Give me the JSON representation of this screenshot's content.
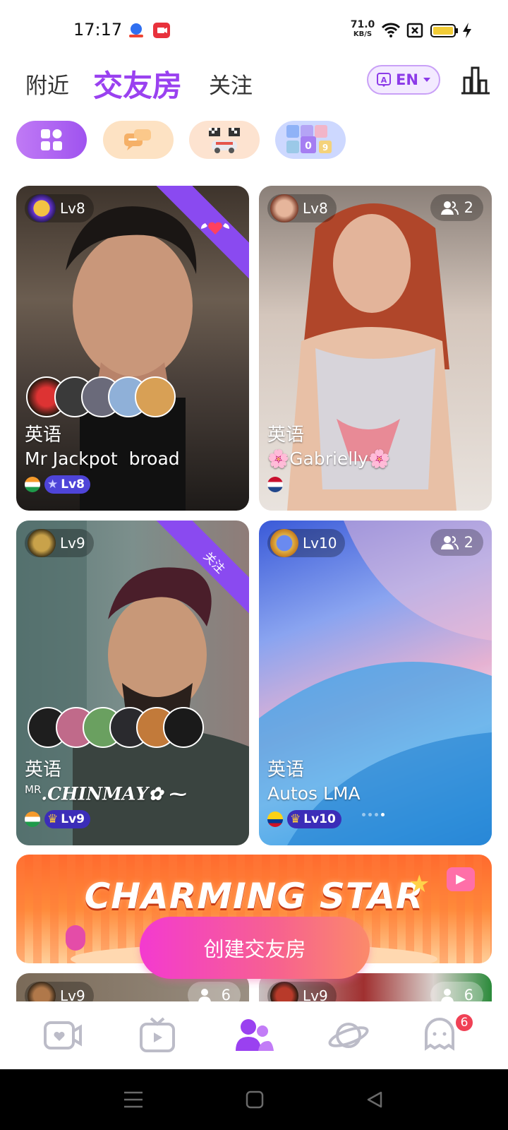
{
  "status_bar": {
    "time": "17:17",
    "net_speed": "71.0",
    "net_unit": "KB/S",
    "icons": [
      "baidu-icon",
      "screen-record-icon",
      "wifi-icon",
      "sim-off-icon",
      "battery-icon",
      "charging-icon"
    ]
  },
  "header": {
    "tabs": [
      {
        "label": "附近"
      },
      {
        "label": "交友房"
      },
      {
        "label": "关注"
      }
    ],
    "language_button": "EN",
    "icons": [
      "translate-icon",
      "leaderboard-icon"
    ]
  },
  "categories": [
    {
      "icon": "grid-icon",
      "color": "#a45cf2"
    },
    {
      "icon": "chat-bubbles-icon",
      "color": "#fde0bd"
    },
    {
      "icon": "racing-game-icon",
      "color": "#fde0cc"
    },
    {
      "icon": "number-game-icon",
      "color": "#c8d4ff"
    }
  ],
  "rooms": [
    {
      "level": "Lv8",
      "language": "英语",
      "name": "Mr Jackpot  broad",
      "host_level": "Lv8",
      "ribbon_icon": "winged-heart-icon",
      "bg": "#5a4a3e"
    },
    {
      "level": "Lv8",
      "count": "2",
      "language": "英语",
      "name": "🌸Gabrielly🌸",
      "bg": "#c9b8ad"
    },
    {
      "level": "Lv9",
      "ribbon": "关注",
      "language": "英语",
      "name_sup": "MR",
      "name": ".𝑪𝑯𝑰𝑵𝑴𝑨𝒀✿ ⁓",
      "host_level": "Lv9",
      "bg": "#6a7c72"
    },
    {
      "level": "Lv10",
      "count": "2",
      "language": "英语",
      "name": "Autos LMA",
      "host_level": "Lv10",
      "bg": "#7a86d8"
    },
    {
      "level": "Lv9",
      "count": "6"
    },
    {
      "level": "Lv9",
      "count": "6"
    }
  ],
  "banner": {
    "text": "CHARMING STAR",
    "create_button": "创建交友房"
  },
  "bottom_nav": {
    "items": [
      {
        "icon": "video-heart-icon"
      },
      {
        "icon": "tv-play-icon"
      },
      {
        "icon": "party-users-icon",
        "active": true
      },
      {
        "icon": "planet-icon"
      },
      {
        "icon": "ghost-chat-icon",
        "badge": "6"
      }
    ]
  }
}
